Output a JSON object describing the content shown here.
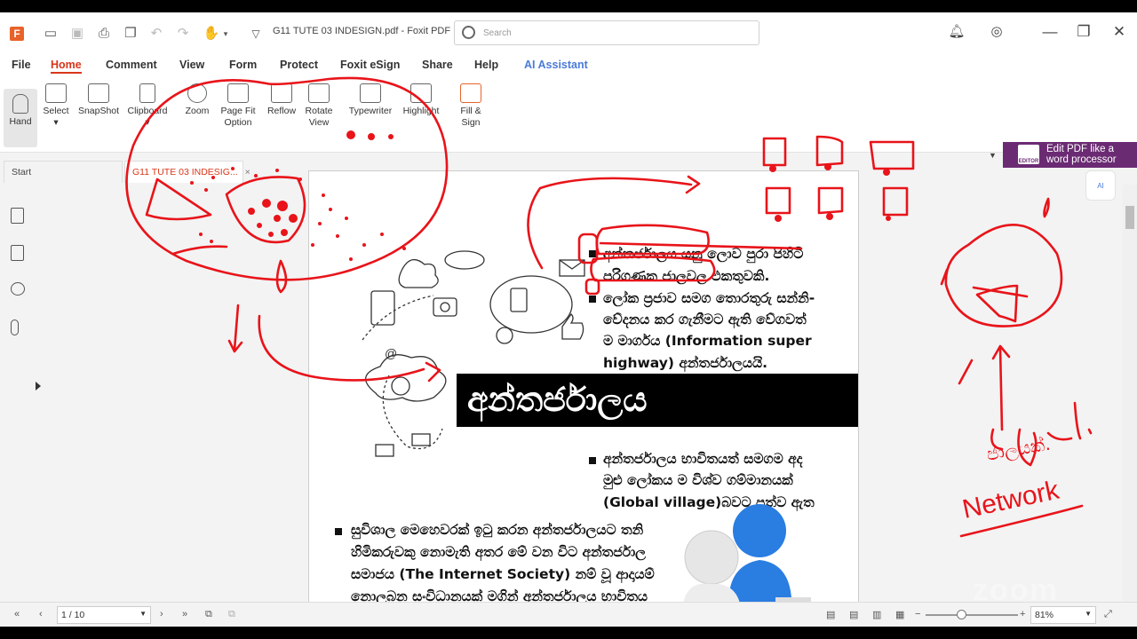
{
  "app": {
    "doc_title": "G11 TUTE 03 INDESIGN.pdf - Foxit PDF R...",
    "search_placeholder": "Search"
  },
  "menu": [
    "File",
    "Home",
    "Comment",
    "View",
    "Form",
    "Protect",
    "Foxit eSign",
    "Share",
    "Help",
    "AI Assistant"
  ],
  "ribbon": {
    "hand": "Hand",
    "select": "Select",
    "snapshot": "SnapShot",
    "clipboard": "Clipboard",
    "zoom": "Zoom",
    "pagefit": "Page Fit",
    "pagefit2": "Option",
    "reflow": "Reflow",
    "rotate": "Rotate",
    "rotate2": "View",
    "typewriter": "Typewriter",
    "highlight": "Highlight",
    "fill": "Fill &",
    "fill2": "Sign"
  },
  "tabs": {
    "start": "Start",
    "doc": "G11 TUTE 03 INDESIG...",
    "close": "×"
  },
  "promo": {
    "line1": "Edit PDF like a",
    "line2": "word processor",
    "badge": "EDITOR"
  },
  "document": {
    "bullets_top": [
      "අන්තර්ජාලය යනු ලොව පුරා පිහිටි",
      "පරිගණක ජාලවල එකතුවකි.",
      "ලෝක ප්‍රජාව සමග තොරතුරු සන්නි-",
      "වේදනය කර ගැනීමට ඇති වේගවත්",
      "ම මාර්ගය (Information super",
      "highway) අන්තර්ජාලයයි."
    ],
    "banner": "අන්තර්ජාලය",
    "bullets_mid": [
      "අන්තර්ජාලය භාවිතයත් සමගම අද",
      "මුළු ලෝකය ම විශ්ව ගම්මානයක්",
      "(Global village)බවට පත්ව ඇත"
    ],
    "bullets_bottom": [
      "සුවිශාල මෙහෙවරක් ඉටු කරන අන්තර්ජාලයට තනි",
      "හිමිකරුවකු නොමැති අතර මේ වන විට අන්තර්ජාල",
      "සමාජය (The Internet Society) නම් වූ ආදායම්",
      "නොලබන සංවිධානයක් මගින් අන්තර්ජාලය භාවිතය"
    ]
  },
  "annotations": {
    "network": "Network",
    "sinhala_note": "ජාලයක්."
  },
  "status": {
    "page": "1 / 10",
    "zoom": "81%"
  },
  "watermark": "zoom",
  "colors": {
    "accent": "#d9361a",
    "ink": "#e8141a",
    "promo": "#6b2b73"
  }
}
